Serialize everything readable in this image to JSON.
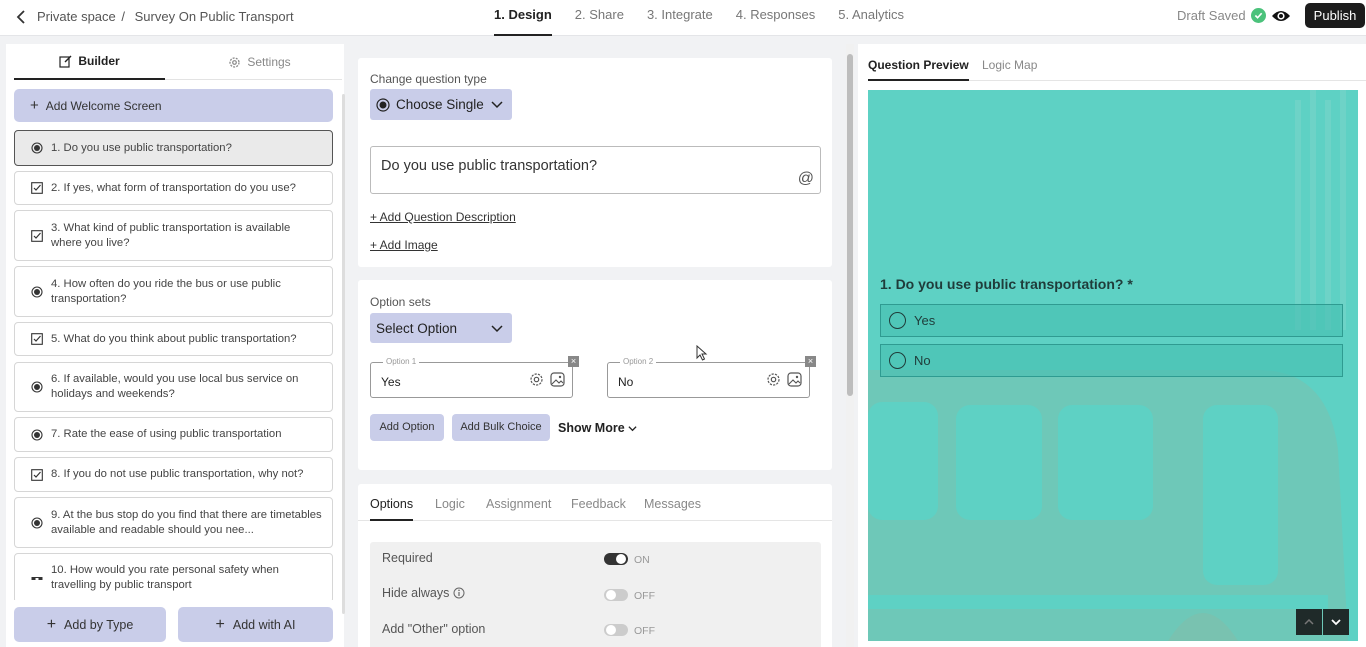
{
  "header": {
    "breadcrumb_root": "Private space",
    "breadcrumb_sep": "/",
    "survey_title": "Survey On Public Transport",
    "steps": [
      "1. Design",
      "2. Share",
      "3. Integrate",
      "4. Responses",
      "5. Analytics"
    ],
    "active_step": "1. Design",
    "draft_status": "Draft Saved",
    "publish_label": "Publish"
  },
  "builder": {
    "tabs": [
      "Builder",
      "Settings"
    ],
    "welcome_label": "Add Welcome Screen",
    "questions": [
      {
        "text": "1. Do you use public transportation?",
        "icon": "radio-icon"
      },
      {
        "text": "2. If yes, what form of transportation do you use?",
        "icon": "checkbox-icon"
      },
      {
        "text": "3. What kind of public transportation is available where you live?",
        "icon": "checkbox-icon"
      },
      {
        "text": "4. How often do you ride the bus or use public transportation?",
        "icon": "radio-icon"
      },
      {
        "text": "5. What do you think about public transportation?",
        "icon": "checkbox-icon"
      },
      {
        "text": "6. If available, would you use local bus service on holidays and weekends?",
        "icon": "radio-icon"
      },
      {
        "text": "7. Rate the ease of using public transportation",
        "icon": "radio-icon"
      },
      {
        "text": "8. If you do not use public transportation, why not?",
        "icon": "checkbox-icon"
      },
      {
        "text": "9. At the bus stop do you find that there are timetables available and readable should you nee...",
        "icon": "radio-icon"
      },
      {
        "text": "10. How would you rate personal safety when travelling by public transport",
        "icon": "scale-icon"
      }
    ],
    "add_by_type": "Add by Type",
    "add_with_ai": "Add with AI"
  },
  "editor": {
    "change_type_label": "Change question type",
    "question_type": "Choose Single",
    "question_text": "Do you use public transportation?",
    "add_description": "+ Add Question Description",
    "add_image": "+ Add Image",
    "option_sets_label": "Option sets",
    "option_sets_value": "Select Option",
    "options": [
      {
        "label": "Option 1",
        "value": "Yes"
      },
      {
        "label": "Option 2",
        "value": "No"
      }
    ],
    "add_option": "Add Option",
    "add_bulk": "Add Bulk Choice",
    "show_more": "Show More",
    "bottom_tabs": [
      "Options",
      "Logic",
      "Assignment",
      "Feedback",
      "Messages"
    ],
    "settings": [
      {
        "label": "Required",
        "state": "ON",
        "on": true
      },
      {
        "label": "Hide always",
        "state": "OFF",
        "on": false
      },
      {
        "label": "Add \"Other\" option",
        "state": "OFF",
        "on": false
      }
    ]
  },
  "preview": {
    "tabs": [
      "Question Preview",
      "Logic Map"
    ],
    "question": "1. Do you use public transportation? *",
    "options": [
      "Yes",
      "No"
    ],
    "bg_color": "#5ed1c4"
  }
}
